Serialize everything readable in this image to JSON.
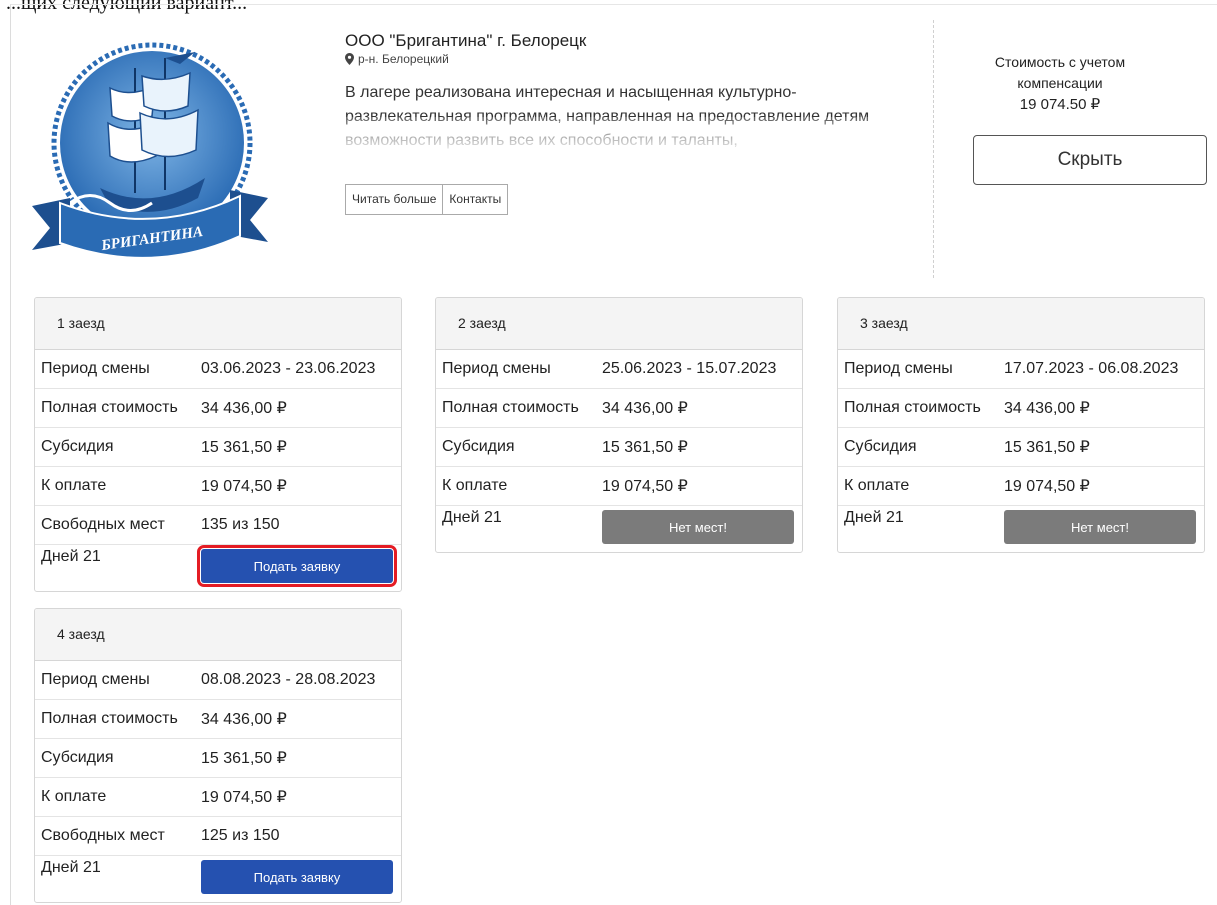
{
  "caption": "...щих следующий вариант...",
  "camp": {
    "title": "ООО \"Бригантина\" г. Белорецк",
    "location": "р-н. Белорецкий",
    "description": "В лагере реализована интересная и насыщенная культурно-развлекательная программа, направленная на предоставление детям возможности развить все их способности и таланты,",
    "read_more": "Читать больше",
    "contacts": "Контакты",
    "logo_text": "БРИГАНТИНА"
  },
  "price": {
    "label_line1": "Стоимость с учетом",
    "label_line2": "компенсации",
    "value": "19 074.50 ₽",
    "hide_label": "Скрыть"
  },
  "labels": {
    "period": "Период смены",
    "full_cost": "Полная стоимость",
    "subsidy": "Субсидия",
    "to_pay": "К оплате",
    "free_places": "Свободных мест",
    "apply": "Подать заявку",
    "no_places": "Нет мест!"
  },
  "sessions": [
    {
      "title": "1 заезд",
      "period": "03.06.2023 - 23.06.2023",
      "full_cost": "34 436,00 ₽",
      "subsidy": "15 361,50 ₽",
      "to_pay": "19 074,50 ₽",
      "free_places": "135 из 150",
      "days": "Дней 21"
    },
    {
      "title": "2 заезд",
      "period": "25.06.2023 - 15.07.2023",
      "full_cost": "34 436,00 ₽",
      "subsidy": "15 361,50 ₽",
      "to_pay": "19 074,50 ₽",
      "days": "Дней 21"
    },
    {
      "title": "3 заезд",
      "period": "17.07.2023 - 06.08.2023",
      "full_cost": "34 436,00 ₽",
      "subsidy": "15 361,50 ₽",
      "to_pay": "19 074,50 ₽",
      "days": "Дней 21"
    },
    {
      "title": "4 заезд",
      "period": "08.08.2023 - 28.08.2023",
      "full_cost": "34 436,00 ₽",
      "subsidy": "15 361,50 ₽",
      "to_pay": "19 074,50 ₽",
      "free_places": "125 из 150",
      "days": "Дней 21"
    }
  ],
  "colors": {
    "apply_button": "#2551b0",
    "no_places_button": "#7b7b7b",
    "highlight": "#e41c24",
    "logo_blue": "#2a6bb4"
  }
}
